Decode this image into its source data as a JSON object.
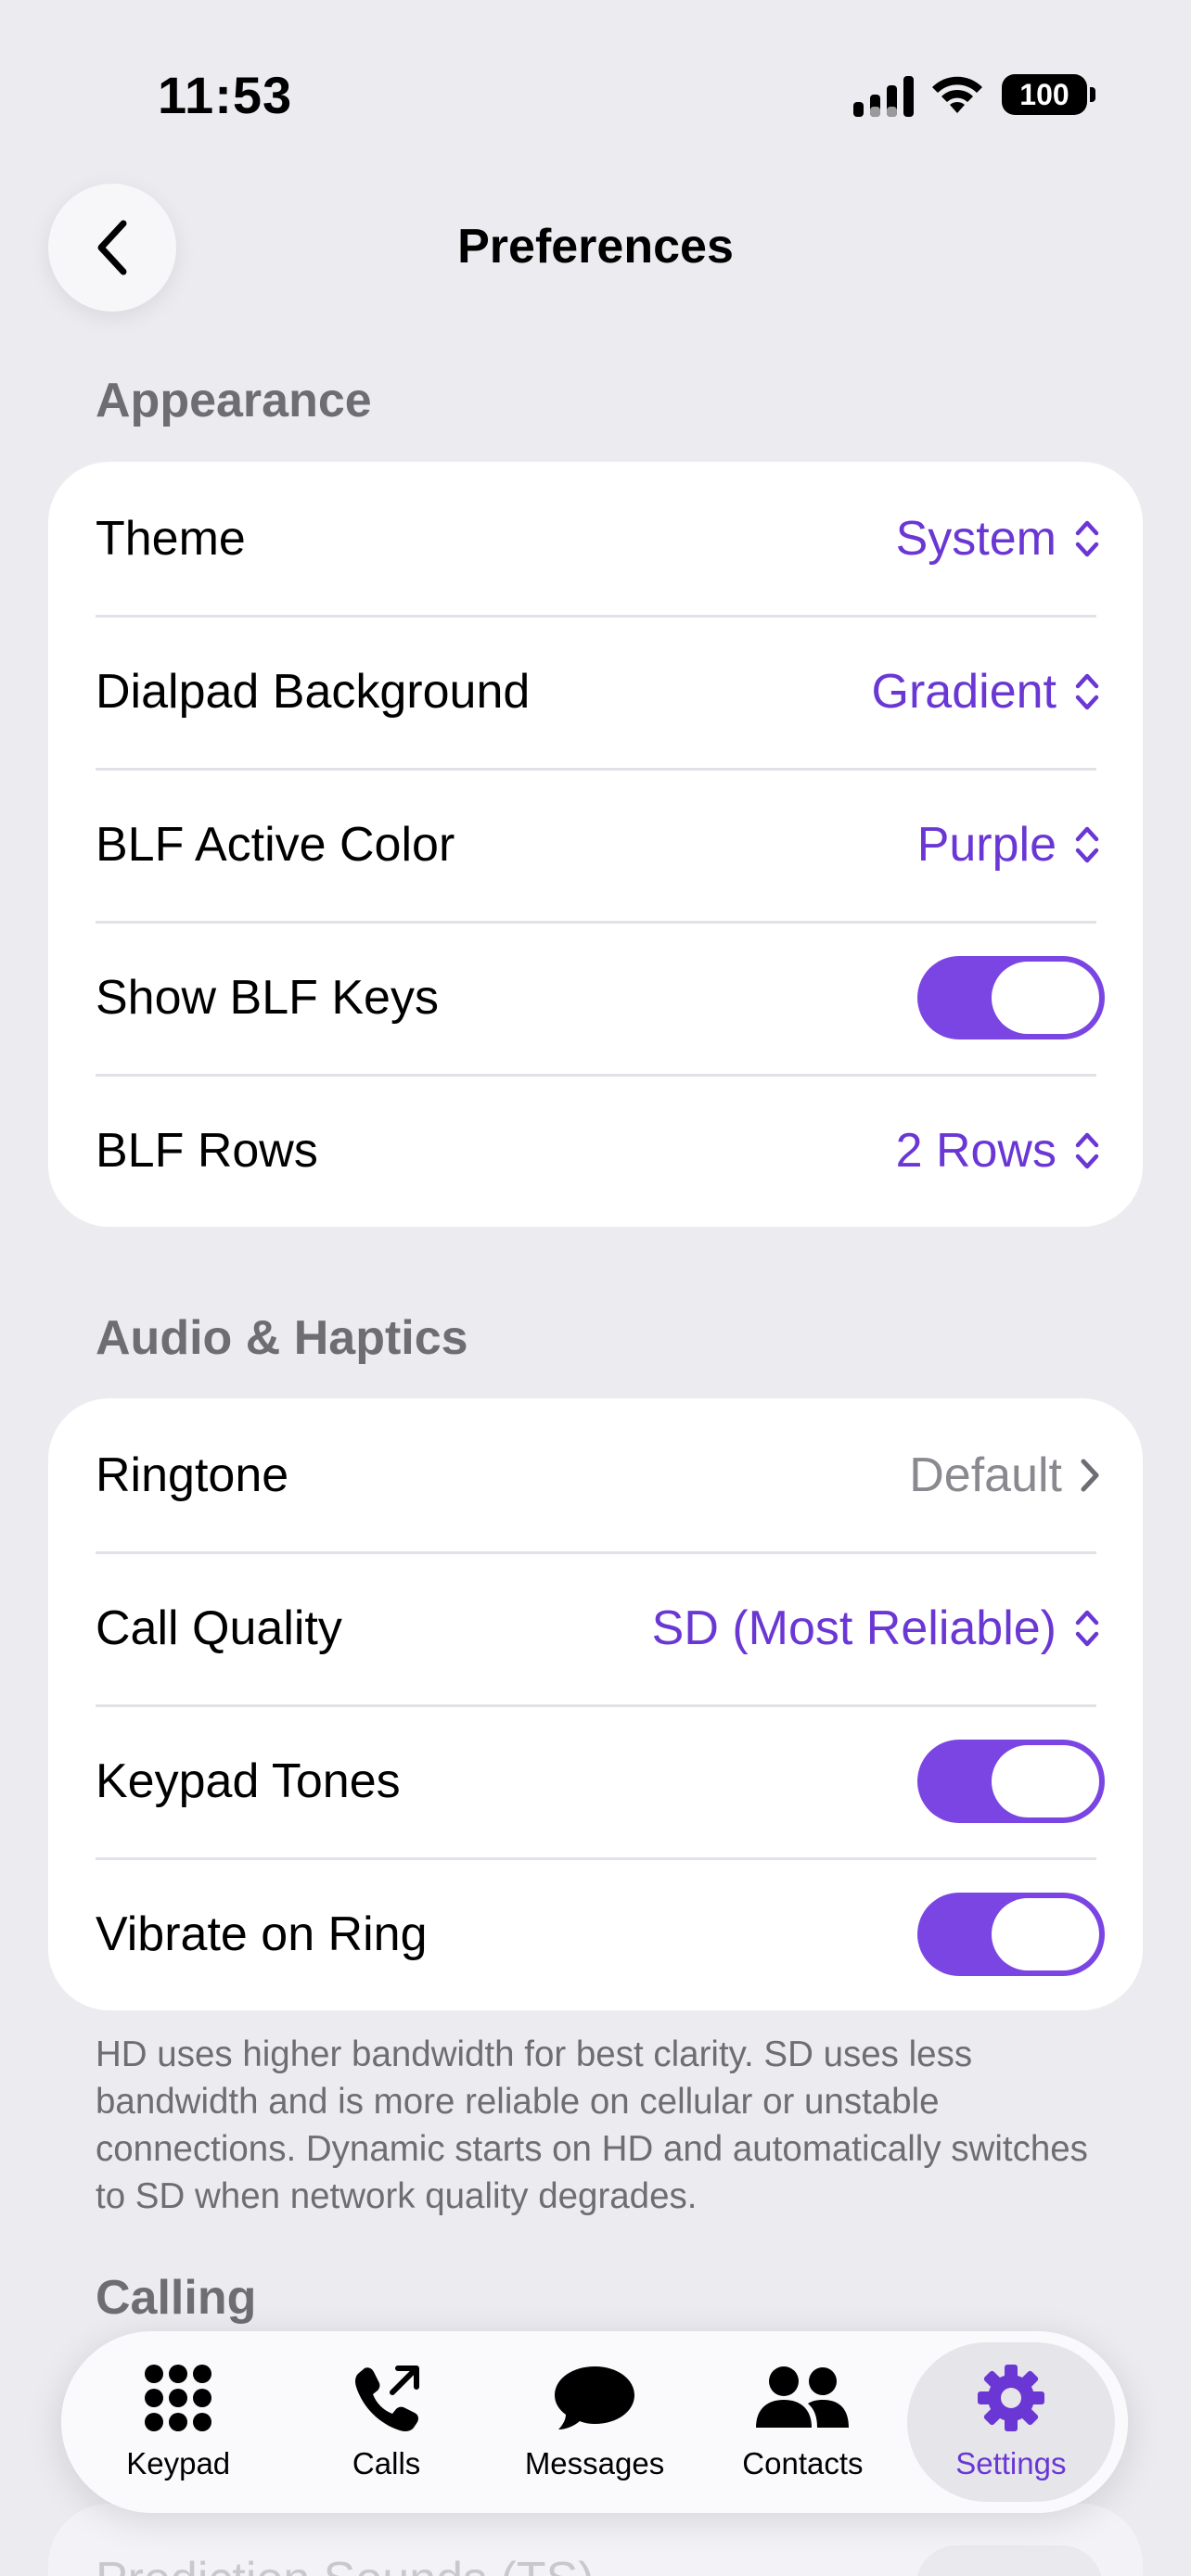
{
  "status_bar": {
    "time": "11:53",
    "battery": "100"
  },
  "nav": {
    "title": "Preferences"
  },
  "appearance": {
    "header": "Appearance",
    "rows": [
      {
        "label": "Theme",
        "value": "System"
      },
      {
        "label": "Dialpad Background",
        "value": "Gradient"
      },
      {
        "label": "BLF Active Color",
        "value": "Purple"
      },
      {
        "label": "Show BLF Keys",
        "toggle": true
      },
      {
        "label": "BLF Rows",
        "value": "2 Rows"
      }
    ]
  },
  "audio": {
    "header": "Audio & Haptics",
    "rows": [
      {
        "label": "Ringtone",
        "value": "Default"
      },
      {
        "label": "Call Quality",
        "value": "SD (Most Reliable)"
      },
      {
        "label": "Keypad Tones",
        "toggle": true
      },
      {
        "label": "Vibrate on Ring",
        "toggle": true
      }
    ],
    "footnote": "HD uses higher bandwidth for best clarity. SD uses less bandwidth and is more reliable on cellular or unstable connections. Dynamic starts on HD and automatically switches to SD when network quality degrades."
  },
  "calling": {
    "header": "Calling",
    "partial_row_label": "Prediction Sounds (TS)"
  },
  "tabs": [
    {
      "label": "Keypad",
      "icon": "keypad-icon"
    },
    {
      "label": "Calls",
      "icon": "phone-outgoing-icon"
    },
    {
      "label": "Messages",
      "icon": "message-bubble-icon"
    },
    {
      "label": "Contacts",
      "icon": "contacts-icon"
    },
    {
      "label": "Settings",
      "icon": "gear-icon",
      "active": true
    }
  ],
  "colors": {
    "accent": "#7A45E3",
    "accent_text": "#6A37D4",
    "background": "#ECEBF0"
  }
}
